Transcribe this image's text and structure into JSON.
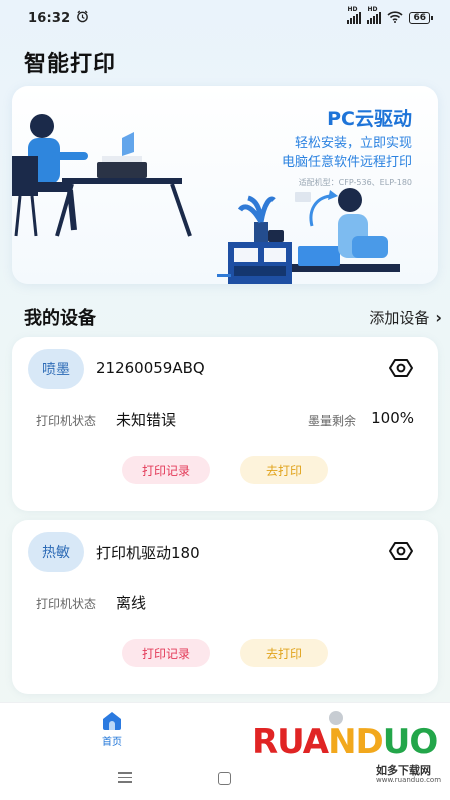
{
  "status_bar": {
    "time": "16:32",
    "battery": "66",
    "signal1_label": "HD",
    "signal2_label": "HD"
  },
  "app_title": "智能打印",
  "banner": {
    "title": "PC云驱动",
    "subtitle_line1": "轻松安装，立即实现",
    "subtitle_line2": "电脑任意软件远程打印",
    "note": "适配机型：CFP-536、ELP-180"
  },
  "devices_section": {
    "title": "我的设备",
    "add_label": "添加设备"
  },
  "devices": [
    {
      "type": "喷墨",
      "name": "21260059ABQ",
      "status_label": "打印机状态",
      "status_value": "未知错误",
      "ink_label": "墨量剩余",
      "ink_value": "100%",
      "record_btn": "打印记录",
      "print_btn": "去打印"
    },
    {
      "type": "热敏",
      "name": "打印机驱动180",
      "status_label": "打印机状态",
      "status_value": "离线",
      "record_btn": "打印记录",
      "print_btn": "去打印"
    }
  ],
  "tab_bar": {
    "home_label": "首页"
  },
  "watermark": {
    "logo": "RUANDUO",
    "line1": "如多下载网",
    "line2": "www.ruanduo.com"
  },
  "colors": {
    "accent": "#1e74d8",
    "record_text": "#e33a58",
    "record_bg": "#fde7ec",
    "print_text": "#e0a21a",
    "print_bg": "#fdf3db",
    "badge_bg": "#d8e8f7"
  }
}
